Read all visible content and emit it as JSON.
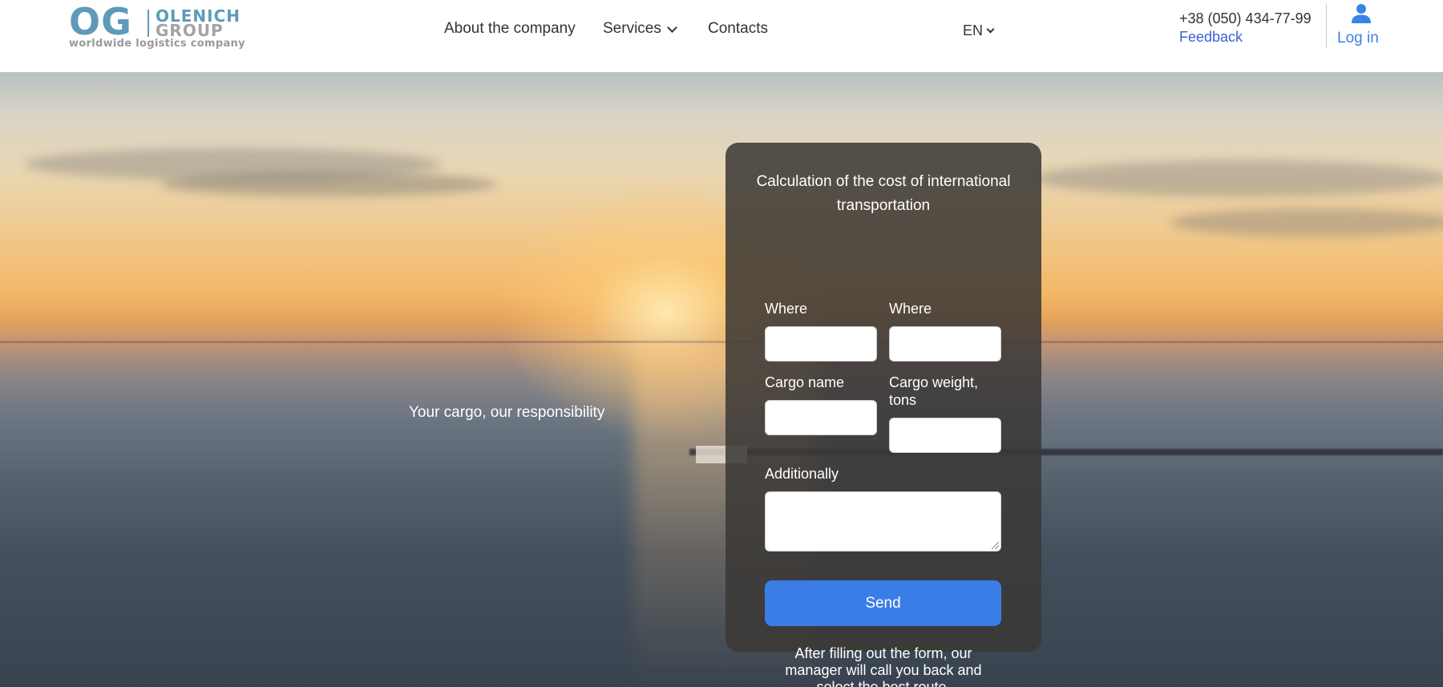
{
  "header": {
    "logo": {
      "mark": "OG",
      "name_line1": "OLENICH",
      "name_line2": "GROUP",
      "tagline": "worldwide logistics company"
    },
    "nav": [
      {
        "label": "About the company"
      },
      {
        "label": "Services",
        "icon": "chevron-down-icon"
      },
      {
        "label": "Contacts"
      }
    ],
    "language": "EN",
    "phone": "+38 (050) 434-77-99",
    "feedback": "Feedback",
    "login": "Log in"
  },
  "hero": {
    "tagline": "Your cargo, our responsibility"
  },
  "form": {
    "title": "Calculation of the cost of international transportation",
    "fields": [
      {
        "label": "Where",
        "value": ""
      },
      {
        "label": "Where",
        "value": ""
      },
      {
        "label": "Cargo name",
        "value": ""
      },
      {
        "label": "Cargo weight, tons",
        "value": ""
      }
    ],
    "additional": {
      "label": "Additionally",
      "value": ""
    },
    "send_label": "Send",
    "note": "After filling out the form, our manager will call you back and select the best route."
  },
  "colors": {
    "brand": "#5f9ab9",
    "link": "#3b5fd6",
    "button": "#3b7de6",
    "card": "#3a3836"
  }
}
